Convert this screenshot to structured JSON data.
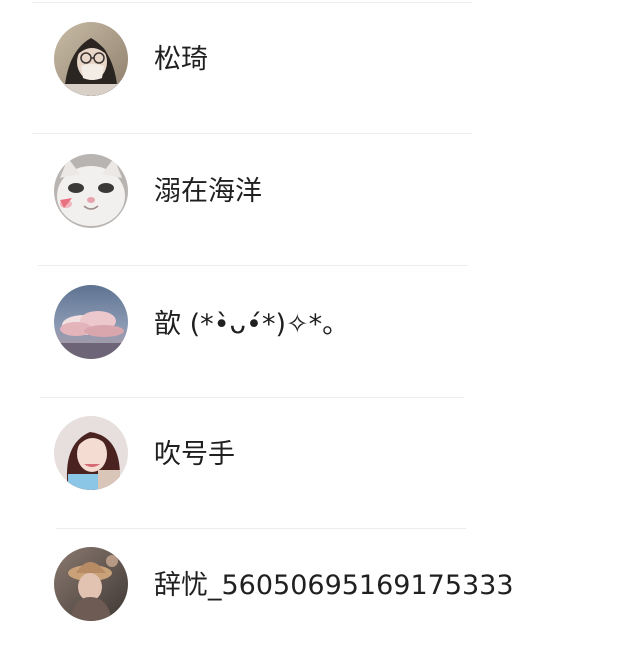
{
  "contacts": [
    {
      "name": "松琦",
      "avatar": "avatar-girl-with-mask-glasses"
    },
    {
      "name": "溺在海洋",
      "avatar": "avatar-white-cat"
    },
    {
      "name": "歆 (*•̀ᴗ•́*)✧*。",
      "avatar": "avatar-pink-clouds-sky"
    },
    {
      "name": "吹号手",
      "avatar": "avatar-smiling-girl-photo"
    },
    {
      "name": "辞忧_56050695169175333",
      "avatar": "avatar-person-with-hat"
    }
  ],
  "colors": {
    "background": "#ffffff",
    "divider": "#ececec",
    "text": "#202020"
  }
}
